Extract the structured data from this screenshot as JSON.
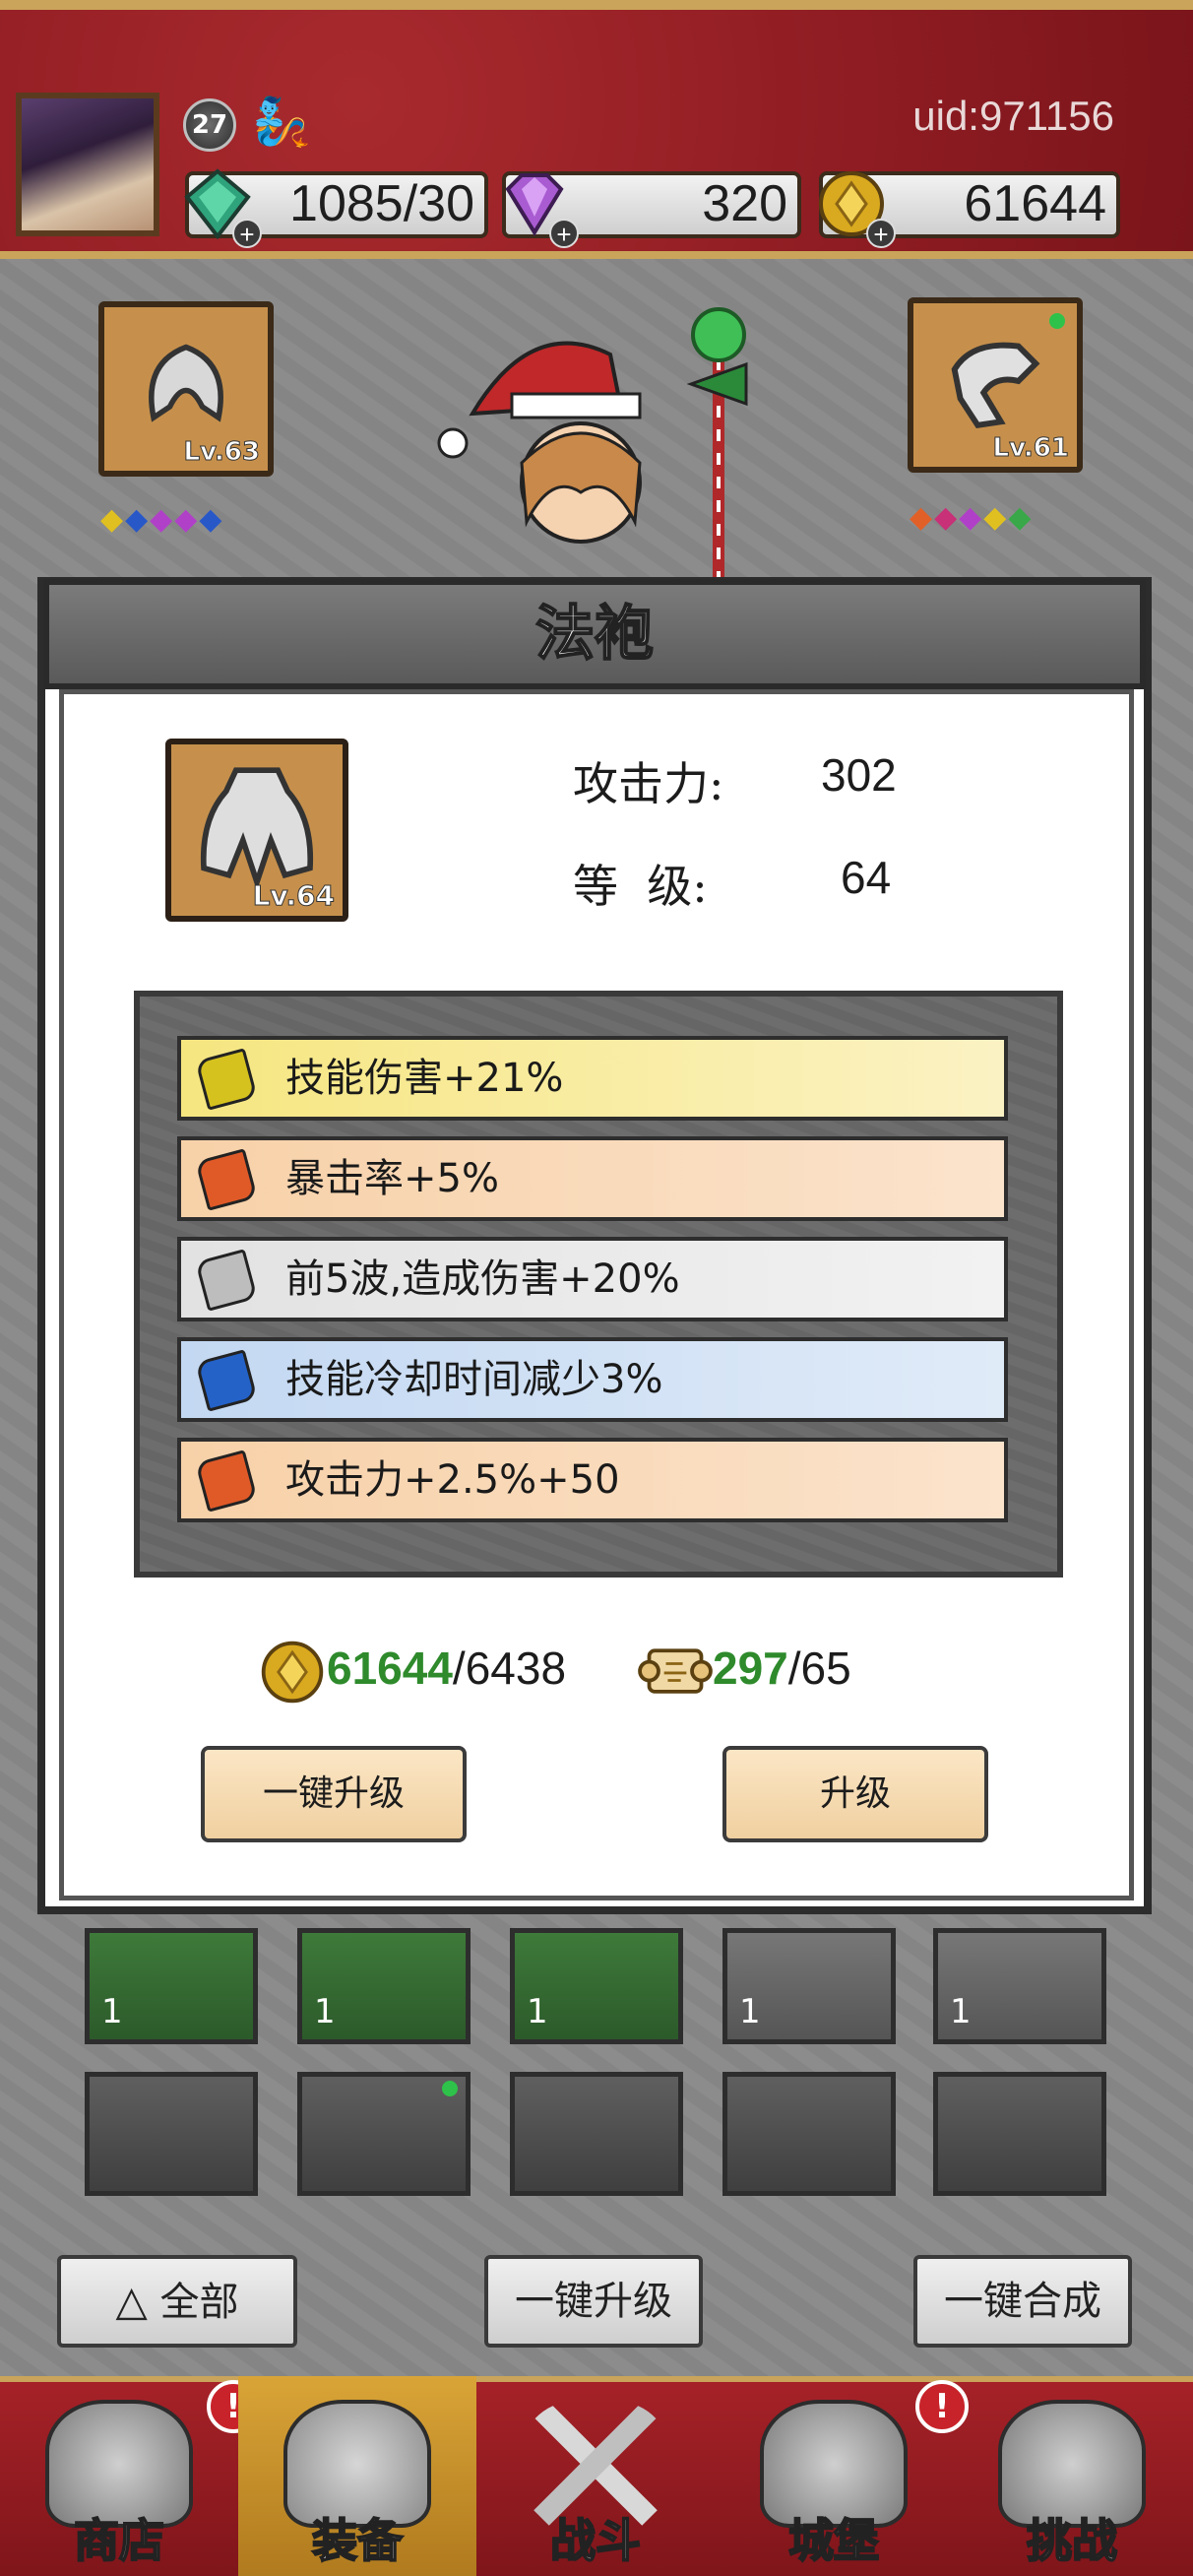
{
  "header": {
    "player_level": "27",
    "uid": "uid:971156",
    "resources": [
      {
        "name": "energy",
        "icon": "green-crystal-icon",
        "value": "1085/30",
        "color": "#2fa37c"
      },
      {
        "name": "diamonds",
        "icon": "purple-diamond-icon",
        "value": "320",
        "color": "#a95bd1"
      },
      {
        "name": "gold",
        "icon": "gold-coin-icon",
        "value": "61644",
        "color": "#d9a91f"
      }
    ]
  },
  "equip_slots": [
    {
      "name": "helmet",
      "level": "Lv.63",
      "gems": [
        "#e0c020",
        "#2858c8",
        "#b040c8",
        "#b040c8",
        "#2858c8"
      ]
    },
    {
      "name": "gloves",
      "level": "Lv.61",
      "gems": [
        "#e06028",
        "#c83078",
        "#b040c8",
        "#e0c020",
        "#38a848"
      ]
    }
  ],
  "modal": {
    "title": "法袍",
    "item_level": "Lv.64",
    "stats": [
      {
        "label": "攻击力:",
        "value": "302"
      },
      {
        "label": "等  级:",
        "value": "64"
      }
    ],
    "attributes": [
      {
        "text": "技能伤害+21%",
        "gem_color": "#d6c21e",
        "bg": "#f9efa0"
      },
      {
        "text": "暴击率+5%",
        "gem_color": "#e05a28",
        "bg": "#f8d9b8"
      },
      {
        "text": "前5波,造成伤害+20%",
        "gem_color": "#bdbdbd",
        "bg": "#e6e6e6"
      },
      {
        "text": "技能冷却时间减少3%",
        "gem_color": "#2462c8",
        "bg": "#cfe0f4"
      },
      {
        "text": "攻击力+2.5%+50",
        "gem_color": "#e05a28",
        "bg": "#f8d9b8"
      }
    ],
    "costs": [
      {
        "icon": "gold-coin-icon",
        "have": "61644",
        "need": "/6438"
      },
      {
        "icon": "scroll-icon",
        "have": "297",
        "need": "/65"
      }
    ],
    "buttons": {
      "upgrade_all": "一键升级",
      "upgrade": "升级"
    }
  },
  "inventory": {
    "row1": [
      {
        "count": "1",
        "type": "green"
      },
      {
        "count": "1",
        "type": "green"
      },
      {
        "count": "1",
        "type": "green"
      },
      {
        "count": "1",
        "type": "gray"
      },
      {
        "count": "1",
        "type": "gray"
      }
    ]
  },
  "bottom_actions": {
    "filter_all": "全部",
    "upgrade_all": "一键升级",
    "merge_all": "一键合成"
  },
  "nav": [
    {
      "label": "商店",
      "icon": "shop-icon",
      "alert": "!"
    },
    {
      "label": "装备",
      "icon": "backpack-icon",
      "active": true
    },
    {
      "label": "战斗",
      "icon": "crossed-swords-icon"
    },
    {
      "label": "城堡",
      "icon": "castle-icon",
      "alert": "!"
    },
    {
      "label": "挑战",
      "icon": "shield-icon"
    }
  ]
}
